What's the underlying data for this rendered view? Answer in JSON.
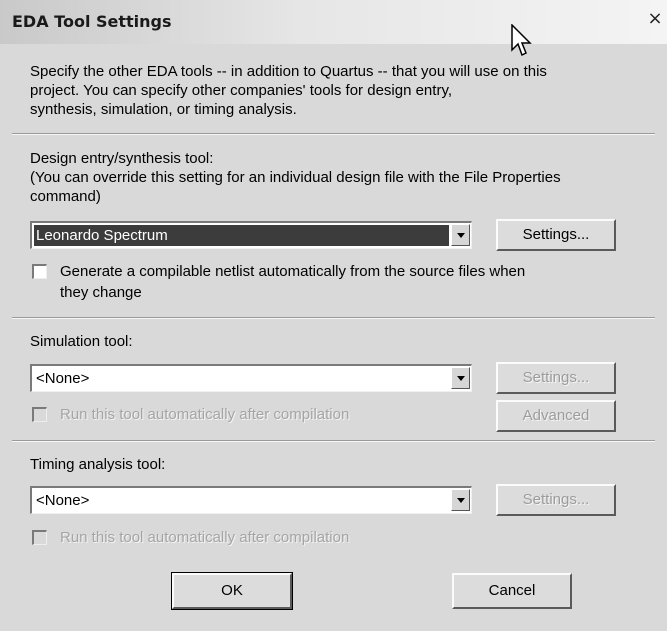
{
  "window": {
    "title": "EDA Tool Settings",
    "close_glyph": "×"
  },
  "intro": {
    "line1": "Specify the other EDA tools -- in addition to Quartus -- that you will use on this",
    "line2": "project.  You can specify other companies' tools for design entry,",
    "line3": "synthesis, simulation, or timing analysis."
  },
  "design_entry": {
    "label": "Design entry/synthesis tool:",
    "note1": "(You can override this setting for an individual design file with the File Properties",
    "note2": "command)",
    "selected": "Leonardo Spectrum",
    "settings_label": "Settings...",
    "checkbox_line1": "Generate a compilable netlist automatically from the source files when",
    "checkbox_line2": "they change",
    "checkbox_checked": false
  },
  "simulation": {
    "label": "Simulation tool:",
    "selected": "<None>",
    "settings_label": "Settings...",
    "advanced_label": "Advanced",
    "checkbox_label": "Run this tool automatically after compilation",
    "checkbox_checked": false
  },
  "timing": {
    "label": "Timing analysis tool:",
    "selected": "<None>",
    "settings_label": "Settings...",
    "checkbox_label": "Run this tool automatically after compilation",
    "checkbox_checked": false
  },
  "footer": {
    "ok_label": "OK",
    "cancel_label": "Cancel"
  },
  "icons": {
    "close": "close-icon",
    "cursor": "mouse-pointer-icon",
    "dropdown": "chevron-down-icon"
  }
}
